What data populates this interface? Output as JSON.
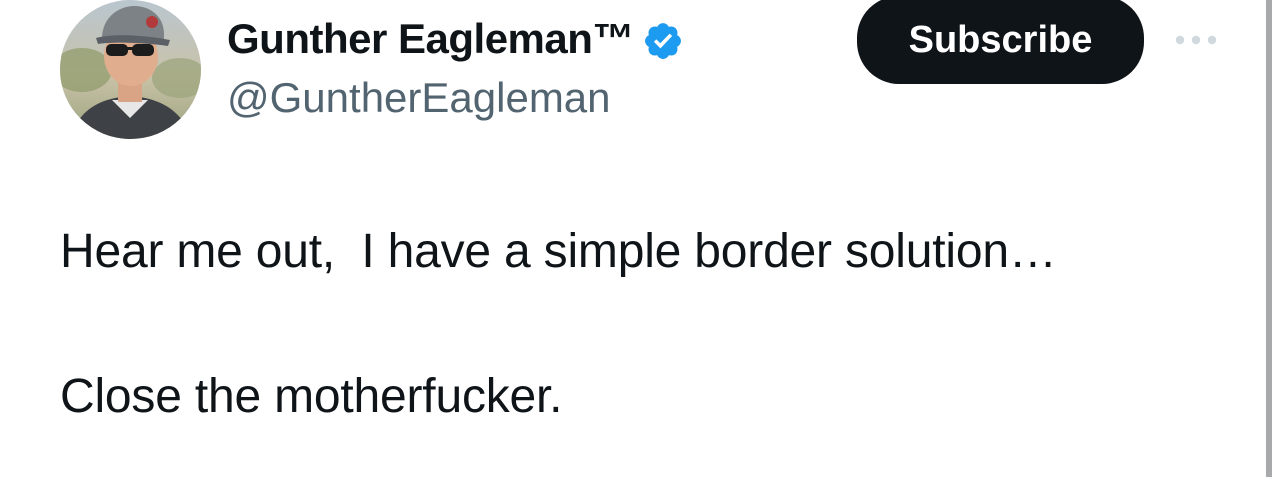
{
  "author": {
    "display_name": "Gunther Eagleman™",
    "handle": "@GuntherEagleman",
    "verified": true,
    "verified_color": "#1d9bf0"
  },
  "actions": {
    "subscribe_label": "Subscribe",
    "more_icon": "more-horizontal-icon"
  },
  "tweet": {
    "lines": [
      "Hear me out,  I have a simple border solution…",
      "Close the motherfucker."
    ]
  },
  "colors": {
    "text": "#0f1419",
    "secondary_text": "#536471",
    "subscribe_bg": "#0f1419",
    "subscribe_text": "#ffffff",
    "more_icon": "#cfd9de"
  }
}
